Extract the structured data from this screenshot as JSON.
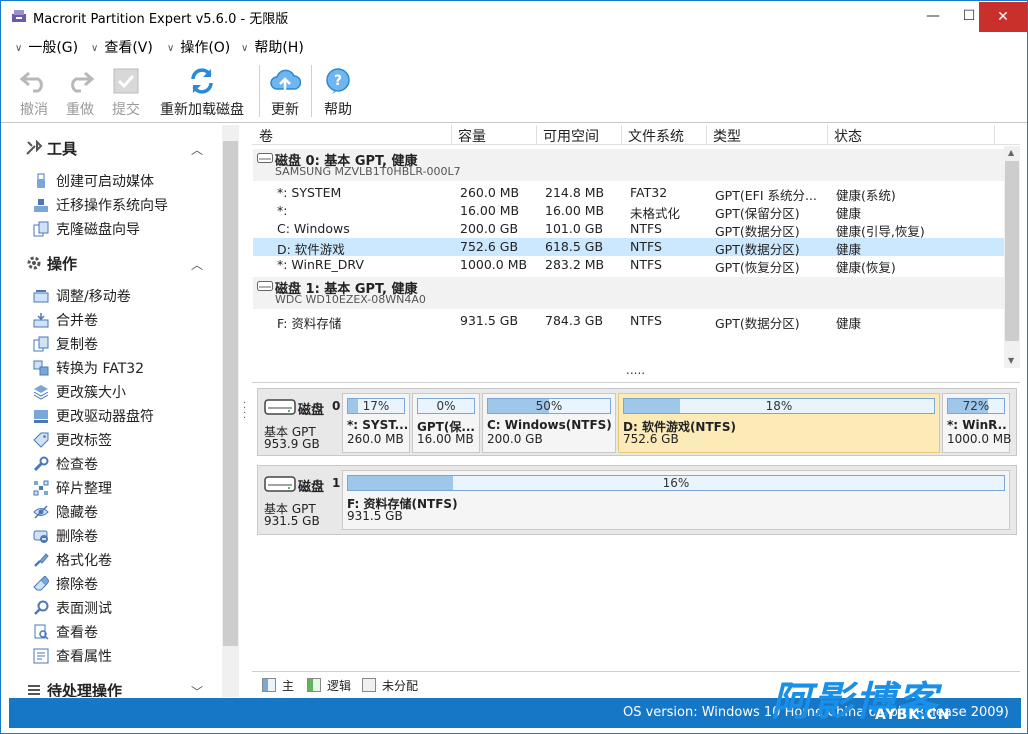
{
  "window": {
    "title": "Macrorit Partition Expert v5.6.0 - 无限版",
    "minimize": "—",
    "maximize": "☐",
    "close": "✕"
  },
  "menu": [
    {
      "label": "一般(G)"
    },
    {
      "label": "查看(V)"
    },
    {
      "label": "操作(O)"
    },
    {
      "label": "帮助(H)"
    }
  ],
  "toolbar": {
    "undo": "撤消",
    "redo": "重做",
    "commit": "提交",
    "reload": "重新加载磁盘",
    "update": "更新",
    "help": "帮助"
  },
  "sidebar": {
    "tools_header": "工具",
    "tools": [
      "创建可启动媒体",
      "迁移操作系统向导",
      "克隆磁盘向导"
    ],
    "ops_header": "操作",
    "ops": [
      "调整/移动卷",
      "合并卷",
      "复制卷",
      "转换为 FAT32",
      "更改簇大小",
      "更改驱动器盘符",
      "更改标签",
      "检查卷",
      "碎片整理",
      "隐藏卷",
      "删除卷",
      "格式化卷",
      "擦除卷",
      "表面测试",
      "查看卷",
      "查看属性"
    ],
    "pending_header": "待处理操作"
  },
  "table": {
    "headers": [
      "卷",
      "容量",
      "可用空间",
      "文件系统",
      "类型",
      "状态"
    ],
    "disks": [
      {
        "name": "磁盘  0: 基本 GPT, 健康",
        "model": "SAMSUNG MZVLB1T0HBLR-000L7",
        "volumes": [
          {
            "vol": "*: SYSTEM",
            "cap": "260.0 MB",
            "free": "214.8 MB",
            "fs": "FAT32",
            "type": "GPT(EFI 系统分...",
            "status": "健康(系统)"
          },
          {
            "vol": "*:",
            "cap": "16.00 MB",
            "free": "16.00 MB",
            "fs": "未格式化",
            "type": "GPT(保留分区)",
            "status": "健康"
          },
          {
            "vol": "C: Windows",
            "cap": "200.0 GB",
            "free": "101.0 GB",
            "fs": "NTFS",
            "type": "GPT(数据分区)",
            "status": "健康(引导,恢复)"
          },
          {
            "vol": "D: 软件游戏",
            "cap": "752.6 GB",
            "free": "618.5 GB",
            "fs": "NTFS",
            "type": "GPT(数据分区)",
            "status": "健康"
          },
          {
            "vol": "*: WinRE_DRV",
            "cap": "1000.0 MB",
            "free": "283.2 MB",
            "fs": "NTFS",
            "type": "GPT(恢复分区)",
            "status": "健康(恢复)"
          }
        ]
      },
      {
        "name": "磁盘  1: 基本 GPT, 健康",
        "model": "WDC WD10EZEX-08WN4A0",
        "volumes": [
          {
            "vol": "F: 资料存储",
            "cap": "931.5 GB",
            "free": "784.3 GB",
            "fs": "NTFS",
            "type": "GPT(数据分区)",
            "status": "健康"
          }
        ]
      }
    ],
    "more": "....."
  },
  "diskmap": [
    {
      "title": "磁盘",
      "num": "0",
      "type": "基本 GPT",
      "size": "953.9 GB",
      "parts": [
        {
          "pct_label": "17%",
          "used_fraction": 0.17,
          "name": "*: SYST...",
          "size": "260.0 MB"
        },
        {
          "pct_label": "0%",
          "used_fraction": 0.0,
          "name": "GPT(保...",
          "size": "16.00 MB"
        },
        {
          "pct_label": "50%",
          "used_fraction": 0.5,
          "name": "C: Windows(NTFS)",
          "size": "200.0 GB"
        },
        {
          "pct_label": "18%",
          "used_fraction": 0.18,
          "name": "D: 软件游戏(NTFS)",
          "size": "752.6 GB"
        },
        {
          "pct_label": "72%",
          "used_fraction": 0.72,
          "name": "*: WinR...",
          "size": "1000.0 MB"
        }
      ]
    },
    {
      "title": "磁盘",
      "num": "1",
      "type": "基本 GPT",
      "size": "931.5 GB",
      "parts": [
        {
          "pct_label": "16%",
          "used_fraction": 0.16,
          "name": "F: 资料存储(NTFS)",
          "size": "931.5 GB"
        }
      ]
    }
  ],
  "legend": {
    "primary": "主",
    "logical": "逻辑",
    "unallocated": "未分配"
  },
  "status": {
    "os_version": "OS version: Windows 10 Home China 64-bit (Release 2009)"
  },
  "watermark": {
    "text": "阿影博客",
    "sub": "AYBK.CN"
  },
  "colors": {
    "accent": "#1677c6",
    "selection": "#cce8ff",
    "selected_partition": "#fdebb7",
    "usage_fill": "#9ec7ea"
  }
}
